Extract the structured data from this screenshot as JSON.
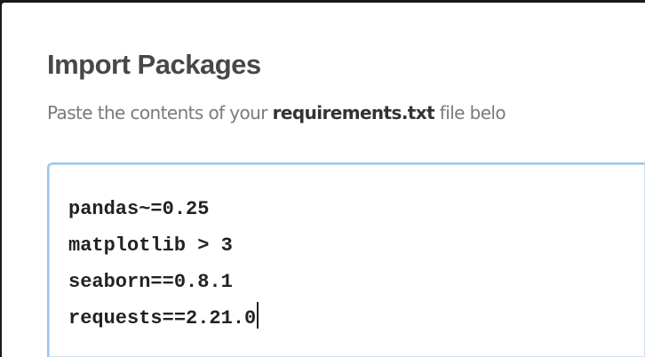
{
  "dialog": {
    "title": "Import Packages",
    "subtitle_prefix": "Paste the contents of your ",
    "subtitle_filename": "requirements.txt",
    "subtitle_suffix": " file belo"
  },
  "textarea": {
    "lines": [
      "pandas~=0.25",
      "matplotlib > 3",
      "seaborn==0.8.1",
      "requests==2.21.0"
    ]
  }
}
